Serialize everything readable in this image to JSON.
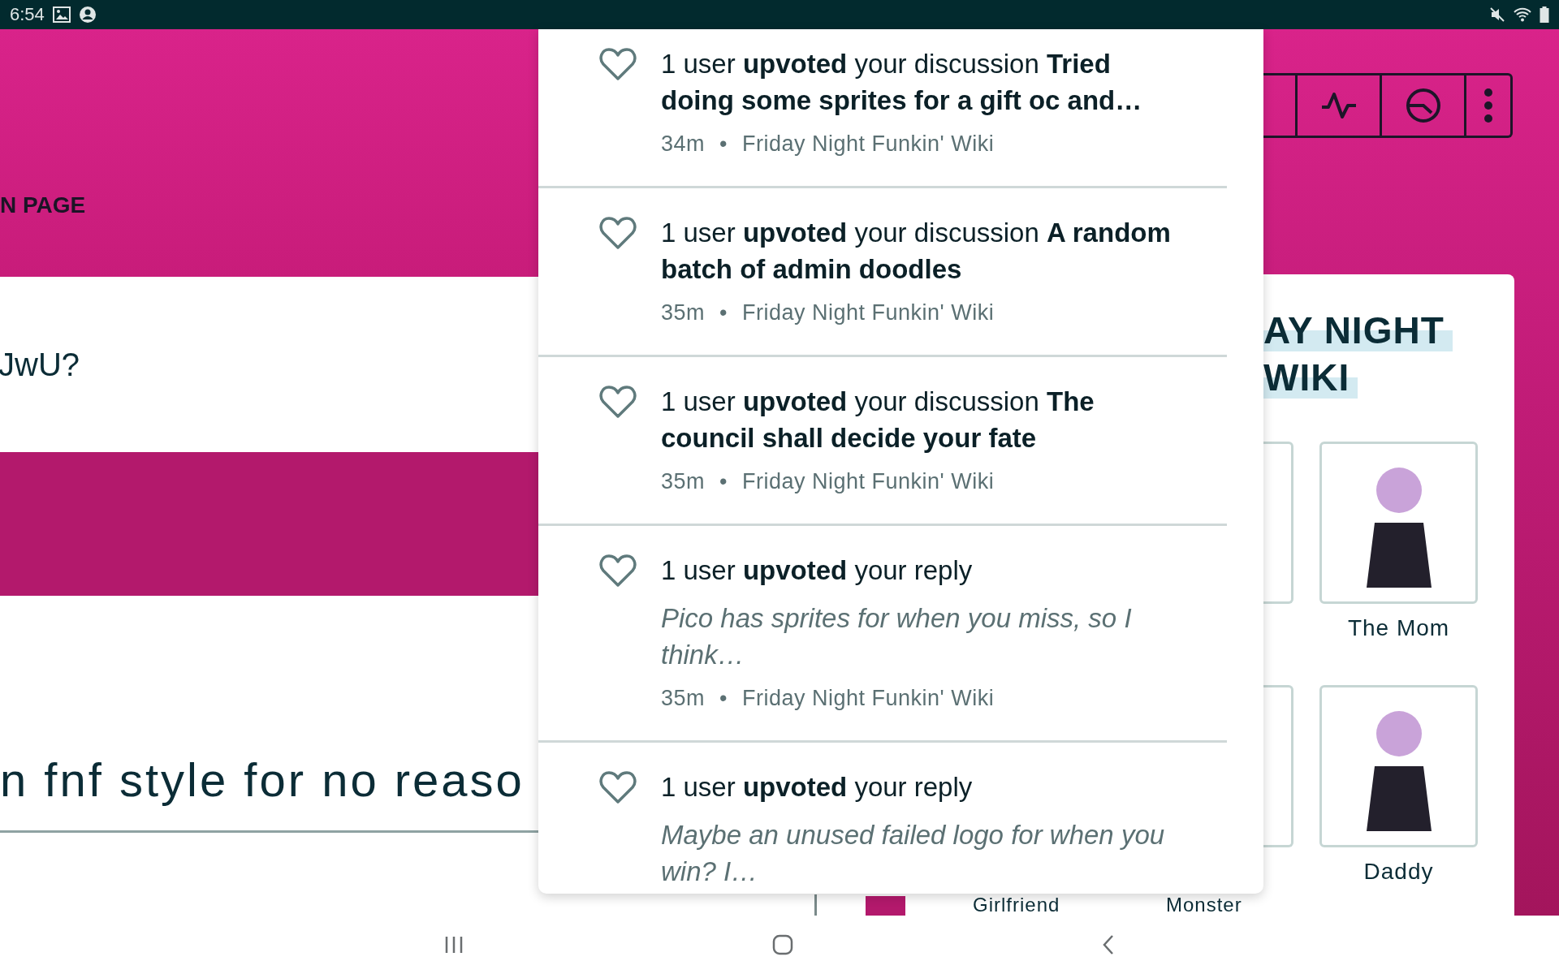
{
  "status_bar": {
    "time": "6:54"
  },
  "background_page": {
    "header_label": "N PAGE",
    "teaser_text": "JwU?",
    "post_title": "n fnf style for no reaso",
    "bottom_labels": [
      "Girlfriend",
      "Monster"
    ],
    "sidebar": {
      "title_lines": [
        "AY NIGHT",
        "WIKI"
      ],
      "characters": [
        {
          "name": "The Mom"
        },
        {
          "name": "Daddy"
        }
      ]
    }
  },
  "notifications": [
    {
      "kind": "discussion",
      "text": "1 user **upvoted** your discussion **Tried doing some sprites for a gift oc and…**",
      "time": "34m",
      "separator": "•",
      "source": "Friday Night Funkin' Wiki"
    },
    {
      "kind": "discussion",
      "text": "1 user **upvoted** your discussion **A random batch of admin doodles**",
      "time": "35m",
      "separator": "•",
      "source": "Friday Night Funkin' Wiki"
    },
    {
      "kind": "discussion",
      "text": "1 user **upvoted** your discussion **The council shall decide your fate**",
      "time": "35m",
      "separator": "•",
      "source": "Friday Night Funkin' Wiki"
    },
    {
      "kind": "reply",
      "text": "1 user **upvoted** your reply",
      "quote": "Pico has sprites for when you miss, so I think…",
      "time": "35m",
      "separator": "•",
      "source": "Friday Night Funkin' Wiki"
    },
    {
      "kind": "reply",
      "text": "1 user **upvoted** your reply",
      "quote": "Maybe an unused failed logo for when you win? I…"
    }
  ]
}
